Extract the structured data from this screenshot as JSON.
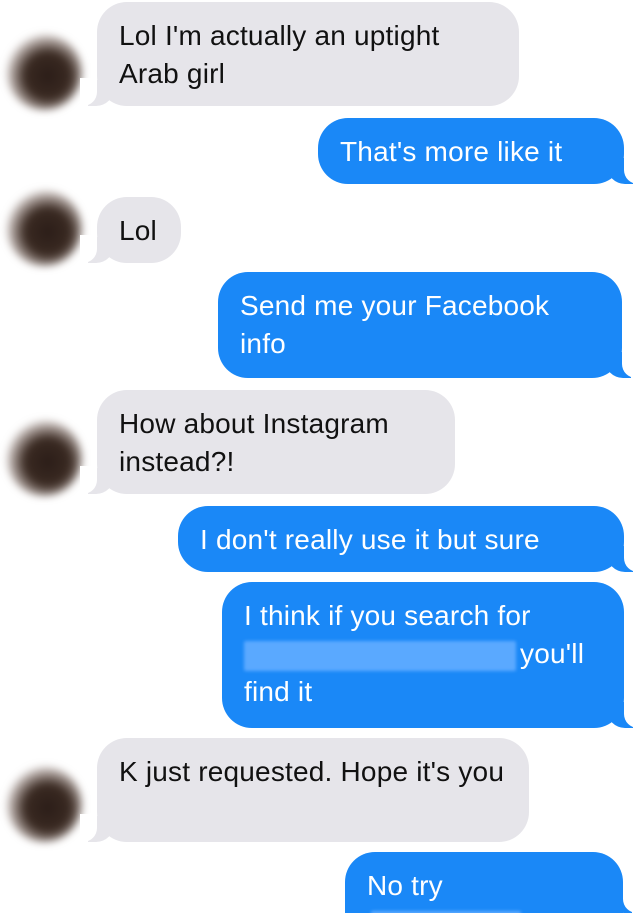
{
  "colors": {
    "sent": "#1a88f7",
    "received": "#e6e5ea",
    "background": "#ffffff"
  },
  "messages": [
    {
      "from": "them",
      "text": "Lol I'm actually an uptight Arab girl"
    },
    {
      "from": "me",
      "text": "That's more like it"
    },
    {
      "from": "them",
      "text": "Lol"
    },
    {
      "from": "me",
      "text": "Send me your Facebook info"
    },
    {
      "from": "them",
      "text": "How about Instagram instead?!"
    },
    {
      "from": "me",
      "text": "I don't really use it but sure"
    },
    {
      "from": "me",
      "text_before": "I think if you search for",
      "text_after": "you'll",
      "text_end": "find it"
    },
    {
      "from": "them",
      "text": "K just requested. Hope it's you"
    },
    {
      "from": "me",
      "text": "No try"
    }
  ]
}
